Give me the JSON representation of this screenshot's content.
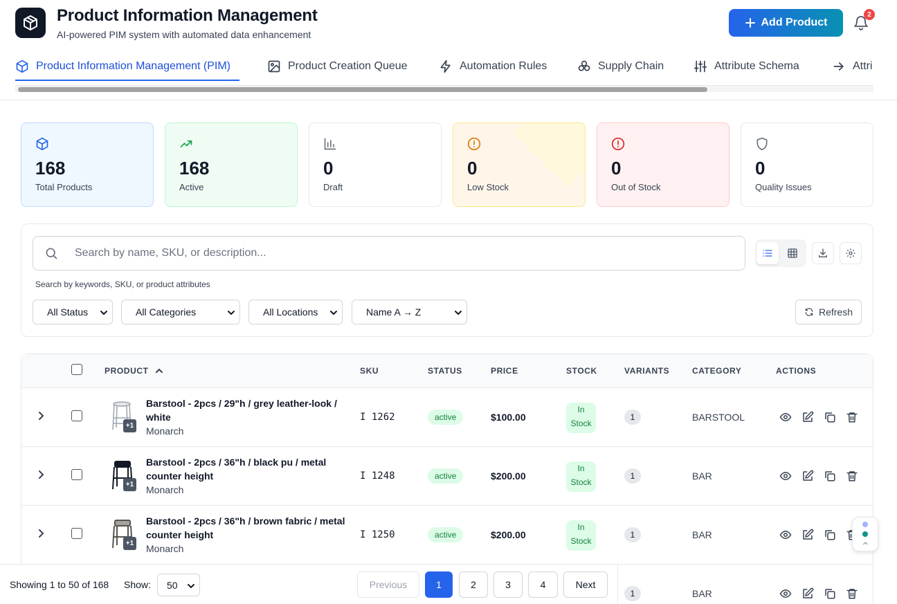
{
  "header": {
    "title": "Product Information Management",
    "subtitle": "AI-powered PIM system with automated data enhancement",
    "add_label": "Add Product",
    "notification_count": "2"
  },
  "tabs": [
    {
      "label": "Product Information Management (PIM)",
      "icon": "box-icon"
    },
    {
      "label": "Product Creation Queue",
      "icon": "image-icon"
    },
    {
      "label": "Automation Rules",
      "icon": "lightning-icon"
    },
    {
      "label": "Supply Chain",
      "icon": "network-icon"
    },
    {
      "label": "Attribute Schema",
      "icon": "sliders-icon"
    },
    {
      "label": "Attri",
      "icon": "arrow-right-icon"
    }
  ],
  "stats": [
    {
      "value": "168",
      "label": "Total Products",
      "icon": "box-icon",
      "color": "#2563eb"
    },
    {
      "value": "168",
      "label": "Active",
      "icon": "trending-up-icon",
      "color": "#16a34a"
    },
    {
      "value": "0",
      "label": "Draft",
      "icon": "bar-chart-icon",
      "color": "#6b7280"
    },
    {
      "value": "0",
      "label": "Low Stock",
      "icon": "alert-circle-icon",
      "color": "#d97706"
    },
    {
      "value": "0",
      "label": "Out of Stock",
      "icon": "alert-circle-icon",
      "color": "#dc2626"
    },
    {
      "value": "0",
      "label": "Quality Issues",
      "icon": "shield-icon",
      "color": "#6b7280"
    }
  ],
  "search": {
    "placeholder": "Search by name, SKU, or description...",
    "help": "Search by keywords, SKU, or product attributes"
  },
  "filters": {
    "status": "All Status",
    "categories": "All Categories",
    "locations": "All Locations",
    "sort": "Name A → Z",
    "refresh_label": "Refresh"
  },
  "table": {
    "headers": {
      "product": "PRODUCT",
      "sku": "SKU",
      "status": "STATUS",
      "price": "PRICE",
      "stock": "STOCK",
      "variants": "VARIANTS",
      "category": "CATEGORY",
      "actions": "ACTIONS"
    },
    "rows": [
      {
        "name": "Barstool - 2pcs / 29\"h / grey leather-look / white",
        "brand": "Monarch",
        "sku": "I 1262",
        "status": "active",
        "price": "$100.00",
        "stock_line1": "In",
        "stock_line2": "Stock",
        "variants": "1",
        "category": "BARSTOOL",
        "image_badge": "+1"
      },
      {
        "name": "Barstool - 2pcs / 36\"h / black pu / metal counter height",
        "brand": "Monarch",
        "sku": "I 1248",
        "status": "active",
        "price": "$200.00",
        "stock_line1": "In",
        "stock_line2": "Stock",
        "variants": "1",
        "category": "BAR",
        "image_badge": "+1"
      },
      {
        "name": "Barstool - 2pcs / 36\"h / brown fabric / metal counter height",
        "brand": "Monarch",
        "sku": "I 1250",
        "status": "active",
        "price": "$200.00",
        "stock_line1": "In",
        "stock_line2": "Stock",
        "variants": "1",
        "category": "BAR",
        "image_badge": "+1"
      },
      {
        "variants": "1",
        "category": "BAR"
      }
    ]
  },
  "pagination": {
    "showing": "Showing 1 to 50 of 168",
    "show_label": "Show:",
    "page_size": "50",
    "previous": "Previous",
    "pages": [
      "1",
      "2",
      "3",
      "4"
    ],
    "next": "Next"
  }
}
